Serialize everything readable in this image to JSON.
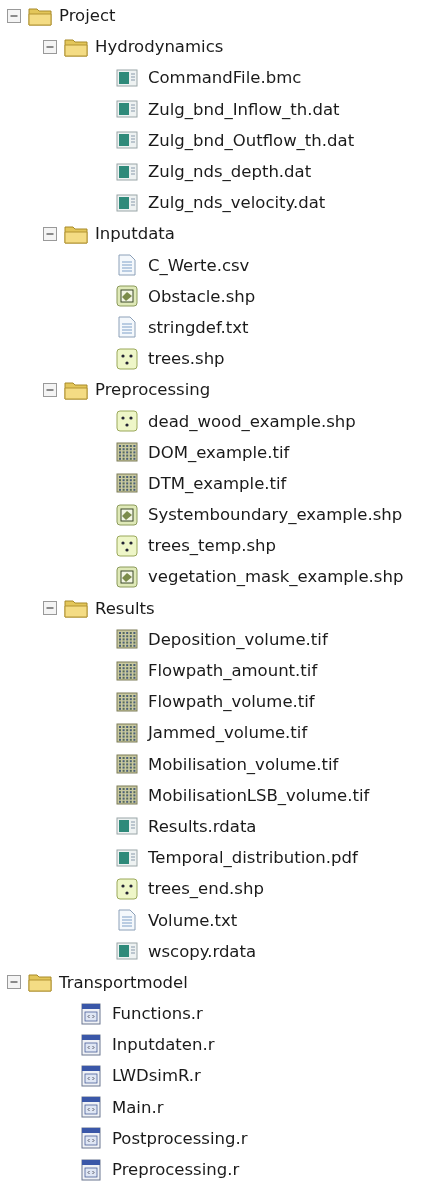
{
  "tree": [
    {
      "kind": "folder",
      "label": "Project",
      "expanded": true,
      "children": [
        {
          "kind": "folder",
          "label": "Hydrodynamics",
          "expanded": true,
          "children": [
            {
              "kind": "table",
              "label": "CommandFile.bmc"
            },
            {
              "kind": "table",
              "label": "Zulg_bnd_Inflow_th.dat"
            },
            {
              "kind": "table",
              "label": "Zulg_bnd_Outflow_th.dat"
            },
            {
              "kind": "table",
              "label": "Zulg_nds_depth.dat"
            },
            {
              "kind": "table",
              "label": "Zulg_nds_velocity.dat"
            }
          ]
        },
        {
          "kind": "folder",
          "label": "Inputdata",
          "expanded": true,
          "children": [
            {
              "kind": "text",
              "label": "C_Werte.csv"
            },
            {
              "kind": "polygon",
              "label": "Obstacle.shp"
            },
            {
              "kind": "text",
              "label": "stringdef.txt"
            },
            {
              "kind": "points",
              "label": "trees.shp"
            }
          ]
        },
        {
          "kind": "folder",
          "label": "Preprocessing",
          "expanded": true,
          "children": [
            {
              "kind": "points",
              "label": "dead_wood_example.shp"
            },
            {
              "kind": "raster",
              "label": "DOM_example.tif"
            },
            {
              "kind": "raster",
              "label": "DTM_example.tif"
            },
            {
              "kind": "polygon",
              "label": "Systemboundary_example.shp"
            },
            {
              "kind": "points",
              "label": "trees_temp.shp"
            },
            {
              "kind": "polygon",
              "label": "vegetation_mask_example.shp"
            }
          ]
        },
        {
          "kind": "folder",
          "label": "Results",
          "expanded": true,
          "children": [
            {
              "kind": "raster",
              "label": "Deposition_volume.tif"
            },
            {
              "kind": "raster",
              "label": "Flowpath_amount.tif"
            },
            {
              "kind": "raster",
              "label": "Flowpath_volume.tif"
            },
            {
              "kind": "raster",
              "label": "Jammed_volume.tif"
            },
            {
              "kind": "raster",
              "label": "Mobilisation_volume.tif"
            },
            {
              "kind": "raster",
              "label": "MobilisationLSB_volume.tif"
            },
            {
              "kind": "table",
              "label": "Results.rdata"
            },
            {
              "kind": "table",
              "label": "Temporal_distribution.pdf"
            },
            {
              "kind": "points",
              "label": "trees_end.shp"
            },
            {
              "kind": "text",
              "label": "Volume.txt"
            },
            {
              "kind": "table",
              "label": "wscopy.rdata"
            }
          ]
        }
      ]
    },
    {
      "kind": "folder",
      "label": "Transportmodel",
      "expanded": true,
      "children": [
        {
          "kind": "script",
          "label": "Functions.r"
        },
        {
          "kind": "script",
          "label": "Inputdaten.r"
        },
        {
          "kind": "script",
          "label": "LWDsimR.r"
        },
        {
          "kind": "script",
          "label": "Main.r"
        },
        {
          "kind": "script",
          "label": "Postprocessing.r"
        },
        {
          "kind": "script",
          "label": "Preprocessing.r"
        }
      ]
    }
  ]
}
